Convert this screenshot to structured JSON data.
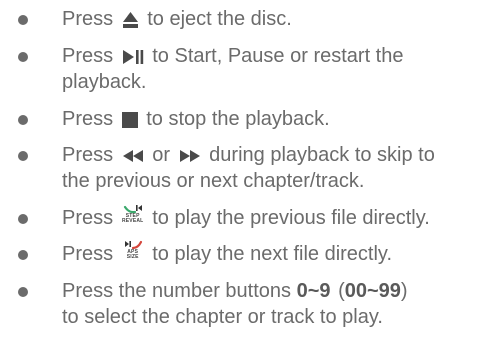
{
  "items": [
    {
      "pre": "Press",
      "post": "to eject the disc."
    },
    {
      "pre": "Press",
      "post": "to Start, Pause or restart the",
      "line2": "playback."
    },
    {
      "pre": "Press",
      "post": "to stop the playback."
    },
    {
      "pre": "Press",
      "mid": "or",
      "post": "during playback to skip to",
      "line2": "the previous or next chapter/track."
    },
    {
      "pre": "Press",
      "post": "to play the previous file directly.",
      "icon_text_1": "STEP",
      "icon_text_2": "REVEAL"
    },
    {
      "pre": "Press",
      "post": "to play the next file directly.",
      "icon_text_1": "APS",
      "icon_text_2": "SIZE"
    },
    {
      "pre": "Press the number buttons",
      "bold1": "0~9",
      "paren_open": "(",
      "bold2": "00~99",
      "paren_close": ")",
      "line2": "to select the chapter or track to play."
    }
  ],
  "colors": {
    "text": "#6b6b6b",
    "icon": "#4a4a4a",
    "green": "#3aa86b",
    "red": "#d4463c"
  }
}
